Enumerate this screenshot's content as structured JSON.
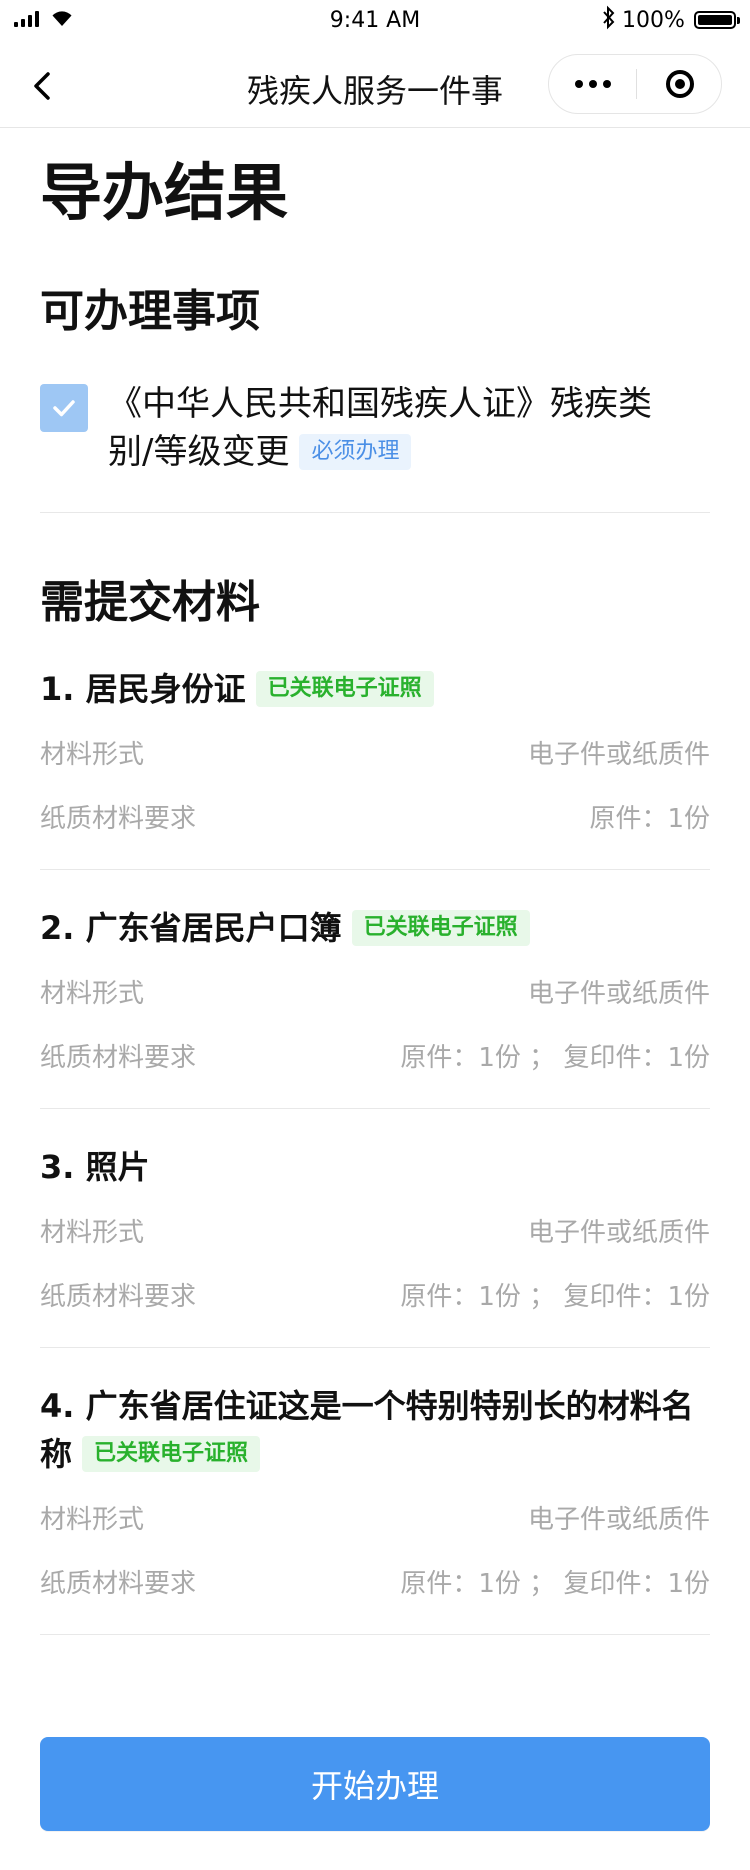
{
  "status_bar": {
    "time": "9:41 AM",
    "battery": "100%"
  },
  "nav": {
    "title": "残疾人服务一件事"
  },
  "page_title": "导办结果",
  "matters": {
    "section_title": "可办理事项",
    "items": [
      {
        "text": "《中华人民共和国残疾人证》残疾类别/等级变更",
        "tag": "必须办理",
        "checked": true
      }
    ]
  },
  "materials": {
    "section_title": "需提交材料",
    "items": [
      {
        "name": "1. 居民身份证",
        "tag": "已关联电子证照",
        "form_label": "材料形式",
        "form_value": "电子件或纸质件",
        "req_label": "纸质材料要求",
        "req_value": "原件：1份"
      },
      {
        "name": "2. 广东省居民户口簿",
        "tag": "已关联电子证照",
        "form_label": "材料形式",
        "form_value": "电子件或纸质件",
        "req_label": "纸质材料要求",
        "req_value": "原件：1份 ； 复印件：1份"
      },
      {
        "name": "3. 照片",
        "tag": "",
        "form_label": "材料形式",
        "form_value": "电子件或纸质件",
        "req_label": "纸质材料要求",
        "req_value": "原件：1份 ； 复印件：1份"
      },
      {
        "name": "4. 广东省居住证这是一个特别特别长的材料名称",
        "tag": "已关联电子证照",
        "form_label": "材料形式",
        "form_value": "电子件或纸质件",
        "req_label": "纸质材料要求",
        "req_value": "原件：1份 ； 复印件：1份"
      }
    ]
  },
  "start_button": "开始办理",
  "colors": {
    "primary": "#4796f1",
    "tag_green": "#29b12d",
    "tag_blue": "#4b8fe6",
    "checkbox": "#9ec7f4"
  }
}
